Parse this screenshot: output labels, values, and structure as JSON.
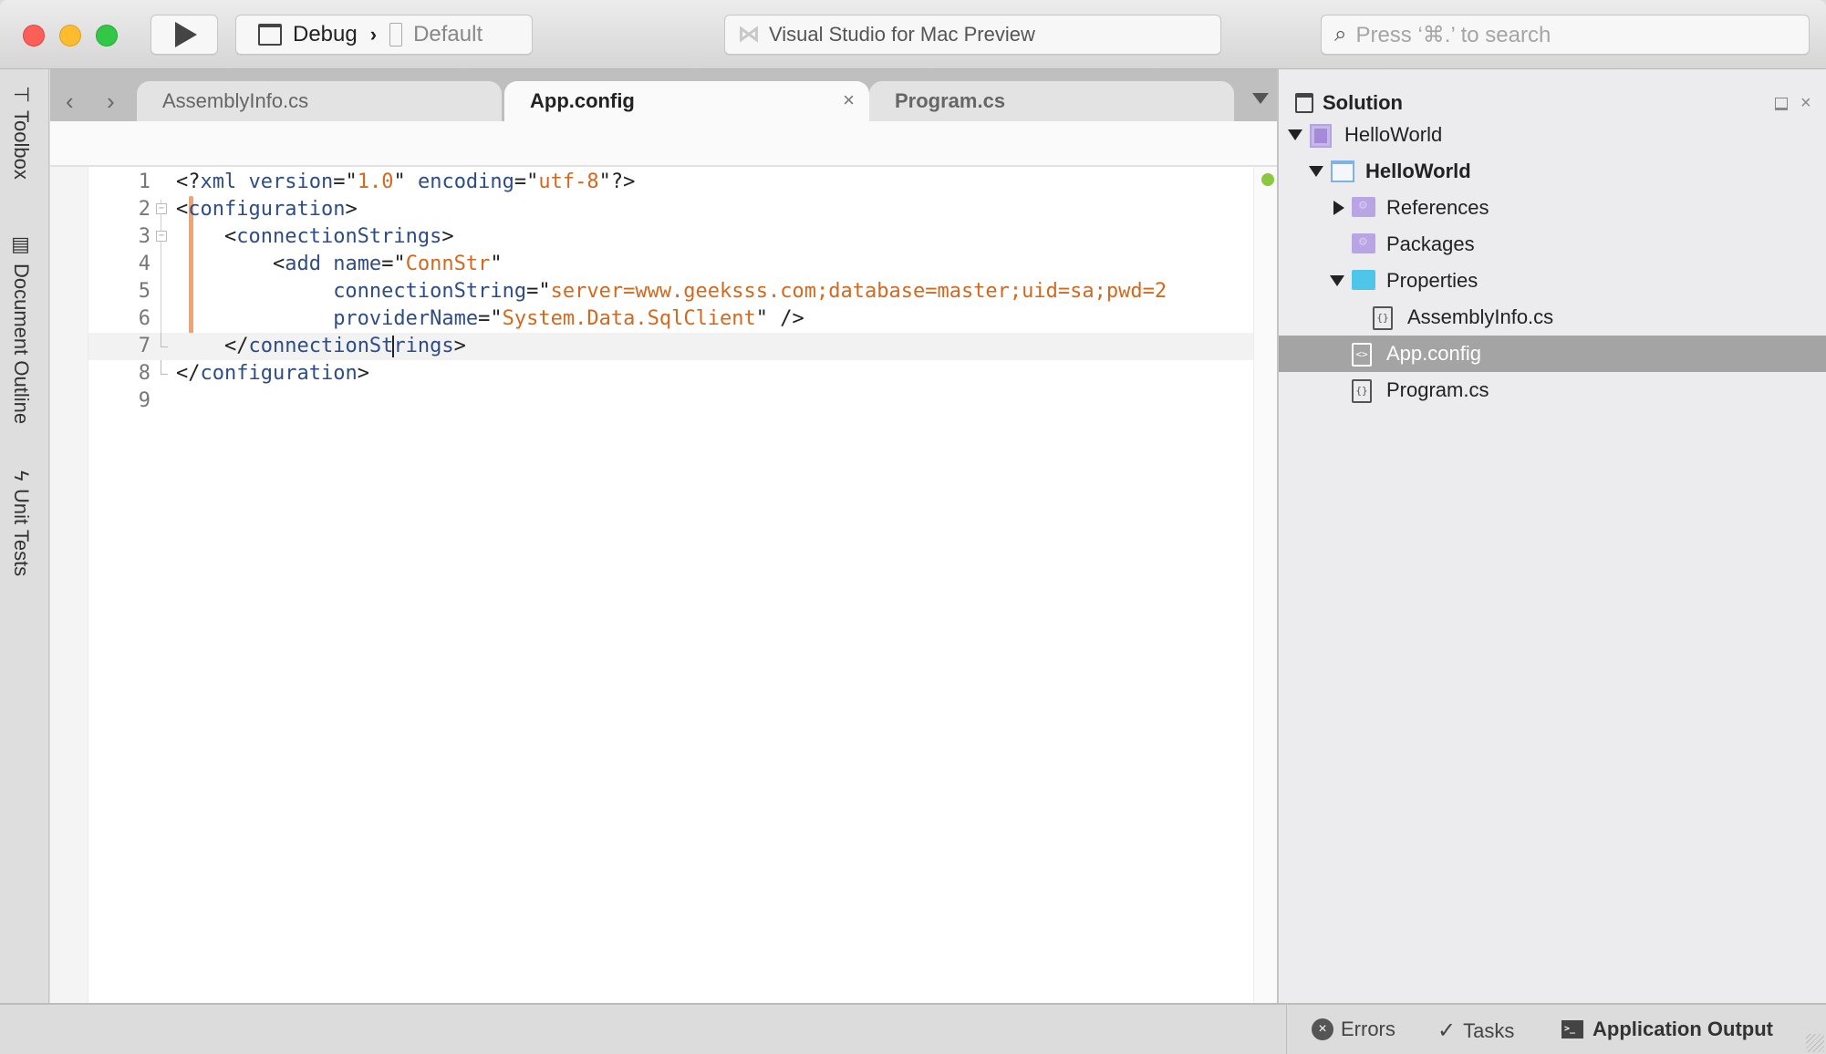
{
  "window": {
    "run_button": "run",
    "configuration": "Debug",
    "config_separator": "›",
    "device": "Default",
    "status_text": "Visual Studio for Mac Preview",
    "search_placeholder": "Press ‘⌘.’ to search"
  },
  "pads": [
    {
      "label": "Toolbox",
      "icon": "hammer-icon"
    },
    {
      "label": "Document Outline",
      "icon": "outline-icon"
    },
    {
      "label": "Unit Tests",
      "icon": "lightning-icon"
    }
  ],
  "tabs": [
    {
      "label": "AssemblyInfo.cs",
      "active": false
    },
    {
      "label": "App.config",
      "active": true,
      "close": "×"
    },
    {
      "label": "Program.cs",
      "active": false
    }
  ],
  "editor": {
    "line_numbers": [
      "1",
      "2",
      "3",
      "4",
      "5",
      "6",
      "7",
      "8",
      "9"
    ],
    "lines": [
      [
        [
          "p",
          "<?"
        ],
        [
          "t",
          "xml version"
        ],
        [
          "p",
          "=\""
        ],
        [
          "s",
          "1.0"
        ],
        [
          "p",
          "\" "
        ],
        [
          "t",
          "encoding"
        ],
        [
          "p",
          "=\""
        ],
        [
          "s",
          "utf-8"
        ],
        [
          "p",
          "\"?>"
        ]
      ],
      [
        [
          "p",
          "<"
        ],
        [
          "t",
          "configuration"
        ],
        [
          "p",
          ">"
        ]
      ],
      [
        [
          "p",
          "    <"
        ],
        [
          "t",
          "connectionStrings"
        ],
        [
          "p",
          ">"
        ]
      ],
      [
        [
          "p",
          "        <"
        ],
        [
          "t",
          "add name"
        ],
        [
          "p",
          "=\""
        ],
        [
          "s",
          "ConnStr"
        ],
        [
          "p",
          "\""
        ]
      ],
      [
        [
          "p",
          "             "
        ],
        [
          "t",
          "connectionString"
        ],
        [
          "p",
          "=\""
        ],
        [
          "s",
          "server=www.geeksss.com;database=master;uid=sa;pwd=2"
        ]
      ],
      [
        [
          "p",
          "             "
        ],
        [
          "t",
          "providerName"
        ],
        [
          "p",
          "=\""
        ],
        [
          "s",
          "System.Data.SqlClient"
        ],
        [
          "p",
          "\" />"
        ]
      ],
      [
        [
          "p",
          "    </"
        ],
        [
          "t",
          "connectionSt"
        ],
        [
          "caret",
          ""
        ],
        [
          "t",
          "rings"
        ],
        [
          "p",
          ">"
        ]
      ],
      [
        [
          "p",
          "</"
        ],
        [
          "t",
          "configuration"
        ],
        [
          "p",
          ">"
        ]
      ],
      []
    ],
    "current_line": 7
  },
  "solution": {
    "title": "Solution",
    "tree": [
      {
        "label": "HelloWorld",
        "type": "solution",
        "expanded": true,
        "level": 0
      },
      {
        "label": "HelloWorld",
        "type": "project",
        "expanded": true,
        "level": 1,
        "bold": true
      },
      {
        "label": "References",
        "type": "special-folder",
        "expanded": false,
        "level": 2
      },
      {
        "label": "Packages",
        "type": "special-folder",
        "level": 2
      },
      {
        "label": "Properties",
        "type": "folder",
        "expanded": true,
        "level": 2
      },
      {
        "label": "AssemblyInfo.cs",
        "type": "cs-file",
        "level": 3
      },
      {
        "label": "App.config",
        "type": "config-file",
        "level": 2,
        "selected": true
      },
      {
        "label": "Program.cs",
        "type": "cs-file",
        "level": 2
      }
    ]
  },
  "bottom": {
    "errors": "Errors",
    "tasks": "Tasks",
    "output": "Application Output"
  },
  "colors": {
    "xml_tag": "#2e4d86",
    "xml_string": "#d2691e",
    "change_marker": "#f5a36b",
    "status_ok": "#8ac93f",
    "selection": "#a4a4a4"
  }
}
